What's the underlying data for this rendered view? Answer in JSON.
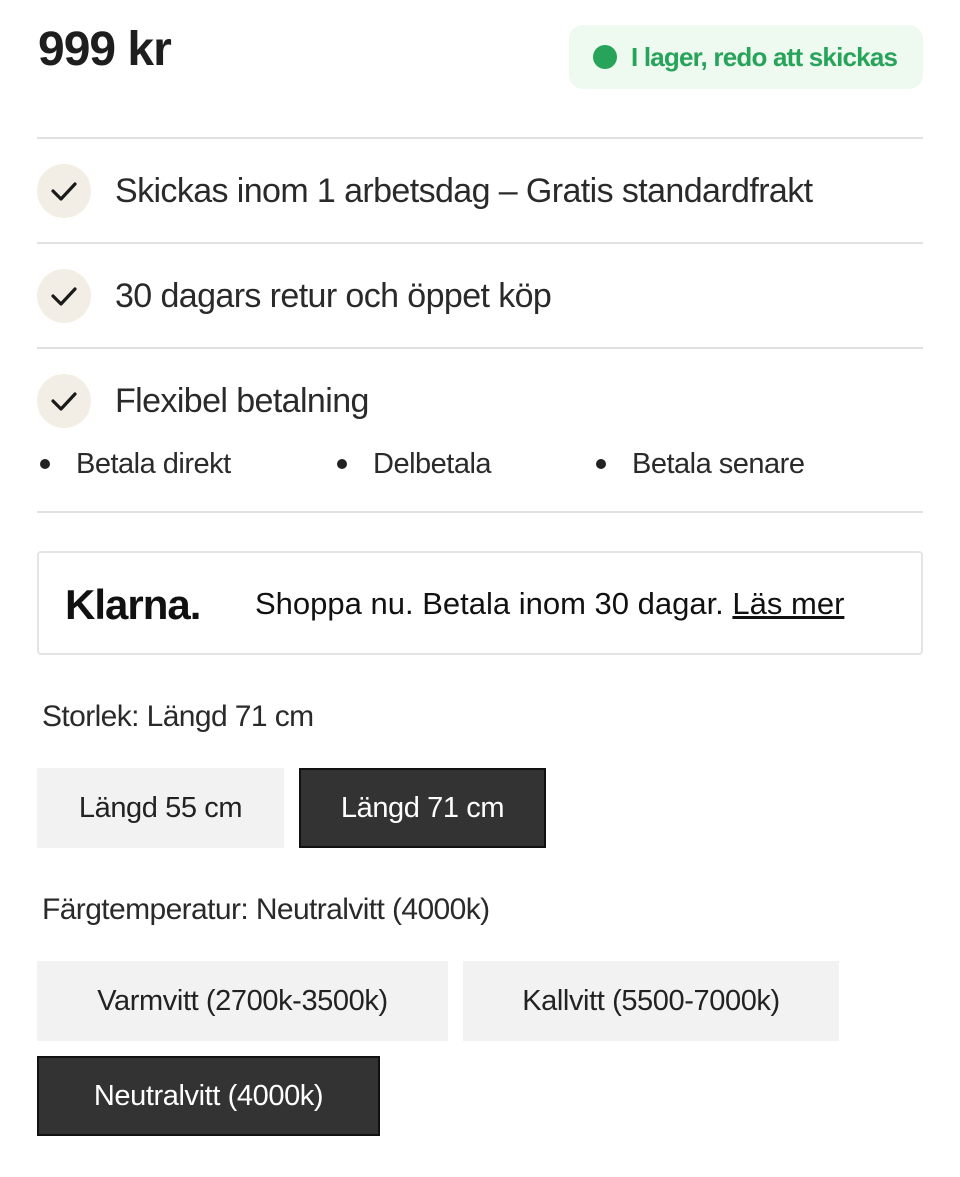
{
  "price": "999 kr",
  "stock": {
    "label": "I lager, redo att skickas",
    "color": "#27a35a"
  },
  "features": [
    {
      "icon": "check-icon",
      "label": "Skickas inom 1 arbetsdag – Gratis standardfrakt"
    },
    {
      "icon": "check-icon",
      "label": "30 dagars retur och öppet köp"
    },
    {
      "icon": "check-icon",
      "label": "Flexibel betalning"
    }
  ],
  "payment_options": [
    "Betala direkt",
    "Delbetala",
    "Betala senare"
  ],
  "klarna": {
    "logo": "Klarna.",
    "message": "Shoppa nu. Betala inom 30 dagar. ",
    "link": "Läs mer"
  },
  "size": {
    "heading": "Storlek: Längd 71 cm",
    "options": [
      {
        "label": "Längd 55 cm",
        "selected": false
      },
      {
        "label": "Längd 71 cm",
        "selected": true
      }
    ]
  },
  "color_temp": {
    "heading": "Färgtemperatur: Neutralvitt (4000k)",
    "options": [
      {
        "label": "Varmvitt (2700k-3500k)",
        "selected": false
      },
      {
        "label": "Kallvitt (5500-7000k)",
        "selected": false
      },
      {
        "label": "Neutralvitt (4000k)",
        "selected": true
      }
    ]
  }
}
